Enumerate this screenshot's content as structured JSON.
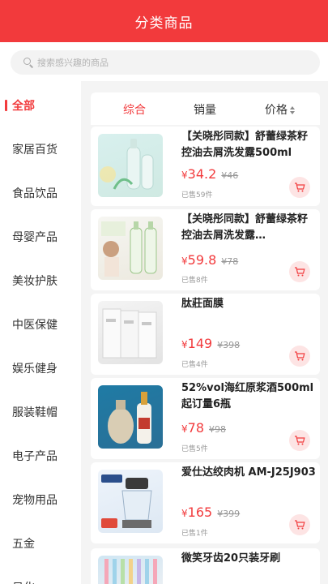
{
  "header": {
    "title": "分类商品"
  },
  "search": {
    "placeholder": "搜索感兴趣的商品"
  },
  "sidebar": {
    "items": [
      {
        "label": "全部",
        "active": true
      },
      {
        "label": "家居百货"
      },
      {
        "label": "食品饮品"
      },
      {
        "label": "母婴产品"
      },
      {
        "label": "美妆护肤"
      },
      {
        "label": "中医保健"
      },
      {
        "label": "娱乐健身"
      },
      {
        "label": "服装鞋帽"
      },
      {
        "label": "电子产品"
      },
      {
        "label": "宠物用品"
      },
      {
        "label": "五金"
      },
      {
        "label": "日化"
      }
    ]
  },
  "sort": {
    "tabs": [
      {
        "label": "综合",
        "active": true
      },
      {
        "label": "销量"
      },
      {
        "label": "价格"
      }
    ]
  },
  "currency": "¥",
  "products": [
    {
      "title": "【关晓彤同款】舒蕾绿茶籽控油去屑洗发露500ml",
      "price": "34.2",
      "orig": "¥46",
      "sold": "已售59件"
    },
    {
      "title": "【关晓彤同款】舒蕾绿茶籽控油去屑洗发露…",
      "price": "59.8",
      "orig": "¥78",
      "sold": "已售8件"
    },
    {
      "title": "肽莊面膜",
      "price": "149",
      "orig": "¥398",
      "sold": "已售4件"
    },
    {
      "title": "52%vol海红原浆酒500ml起订量6瓶",
      "price": "78",
      "orig": "¥98",
      "sold": "已售5件"
    },
    {
      "title": "爱仕达绞肉机 AM-J25J903",
      "price": "165",
      "orig": "¥399",
      "sold": "已售1件"
    },
    {
      "title": "微笑牙齿20只装牙刷",
      "price": "",
      "orig": "",
      "sold": ""
    }
  ],
  "colors": {
    "accent": "#f23a3c",
    "cart_bg": "#fde4e4"
  },
  "icons": {
    "search": "search-icon",
    "cart": "cart-icon",
    "sort": "sort-arrows-icon"
  }
}
